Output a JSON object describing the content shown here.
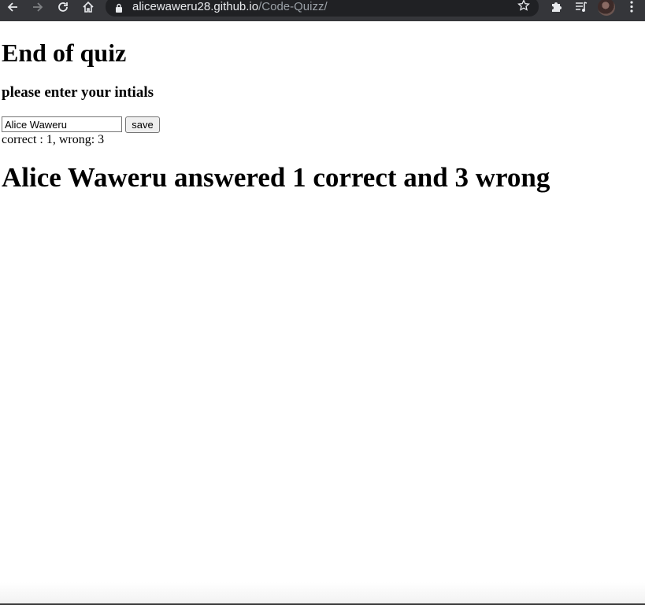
{
  "browser": {
    "url_host": "alicewaweru28.github.io",
    "url_path": "/Code-Quizz/",
    "icons": {
      "back": "back-arrow-icon",
      "forward": "forward-arrow-icon",
      "reload": "reload-icon",
      "home": "home-icon",
      "lock": "lock-icon",
      "bookmark": "star-icon",
      "extensions": "puzzle-icon",
      "media": "media-queue-icon",
      "menu": "kebab-menu-icon"
    }
  },
  "page": {
    "title": "End of quiz",
    "prompt": "please enter your intials",
    "initials_input_value": "Alice Waweru",
    "save_button_label": "save",
    "score_line": "correct : 1, wrong: 3",
    "result_text": "Alice Waweru answered 1 correct and 3 wrong"
  }
}
